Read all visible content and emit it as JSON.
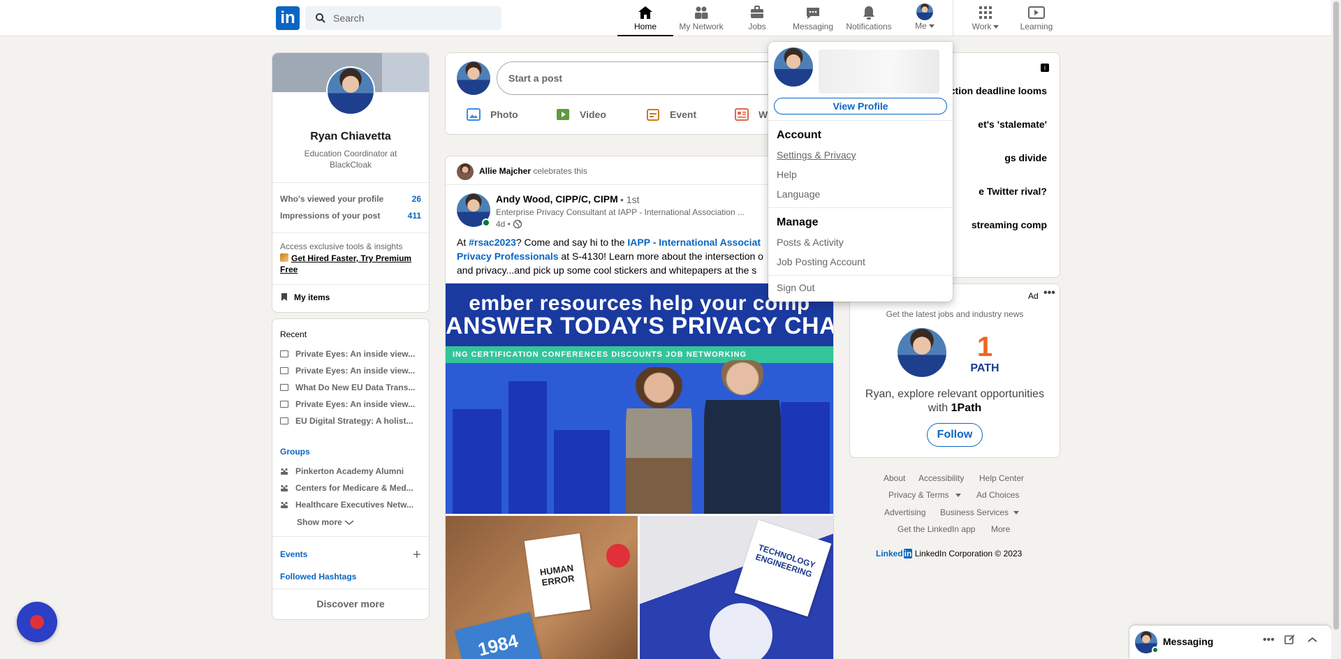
{
  "header": {
    "logo": "in",
    "search_placeholder": "Search",
    "nav": [
      {
        "label": "Home",
        "icon": "home-icon"
      },
      {
        "label": "My Network",
        "icon": "network-icon"
      },
      {
        "label": "Jobs",
        "icon": "briefcase-icon"
      },
      {
        "label": "Messaging",
        "icon": "messaging-icon"
      },
      {
        "label": "Notifications",
        "icon": "bell-icon"
      },
      {
        "label": "Me",
        "icon": "avatar"
      },
      {
        "label": "Work",
        "icon": "grid-icon"
      },
      {
        "label": "Learning",
        "icon": "learning-icon"
      }
    ]
  },
  "profile": {
    "name": "Ryan Chiavetta",
    "headline": "Education Coordinator at BlackCloak",
    "stats": [
      {
        "label": "Who's viewed your profile",
        "value": "26"
      },
      {
        "label": "Impressions of your post",
        "value": "411"
      }
    ],
    "premium_text": "Access exclusive tools & insights",
    "premium_link": "Get Hired Faster, Try Premium Free",
    "my_items": "My items"
  },
  "sidebar": {
    "recent_title": "Recent",
    "recent": [
      "Private Eyes: An inside view...",
      "Private Eyes: An inside view...",
      "What Do New EU Data Trans...",
      "Private Eyes: An inside view...",
      "EU Digital Strategy: A holist..."
    ],
    "groups_title": "Groups",
    "groups": [
      "Pinkerton Academy Alumni",
      "Centers for Medicare & Med...",
      "Healthcare Executives Netw..."
    ],
    "show_more": "Show more",
    "events": "Events",
    "hashtags": "Followed Hashtags",
    "discover": "Discover more"
  },
  "composer": {
    "placeholder": "Start a post",
    "actions": [
      {
        "label": "Photo",
        "color": "#378fe9"
      },
      {
        "label": "Video",
        "color": "#5f9b41"
      },
      {
        "label": "Event",
        "color": "#c37d16"
      },
      {
        "label": "Wr",
        "color": "#e06847"
      }
    ]
  },
  "post": {
    "celebrator": "Allie Majcher",
    "celebrates": "celebrates this",
    "author": "Andy Wood, CIPP/C, CIPM",
    "degree": "• 1st",
    "subtitle": "Enterprise Privacy Consultant at IAPP - International Association ...",
    "time": "4d •",
    "text_1": "At ",
    "tag_1": "#rsac2023",
    "text_2": "? Come and say hi to the ",
    "tag_2": "IAPP - International Associat",
    "tag_3": "Privacy Professionals",
    "text_3": " at S-4130! Learn more about the intersection o",
    "text_4": "and privacy...and pick up some cool stickers and whitepapers at the s",
    "image_banner_1": "ember resources help your comp",
    "image_banner_2": "ANSWER TODAY'S PRIVACY CHALLENG",
    "image_strip": "ING   CERTIFICATION   CONFERENCES   DISCOUNTS   JOB   NETWORKING",
    "book_1": "1984",
    "book_2": "HUMAN ERROR",
    "book_3": "TECHNOLOGY ENGINEERING"
  },
  "news": {
    "items": [
      "ction deadline looms",
      "et's 'stalemate'",
      "gs divide",
      "e Twitter rival?",
      "streaming comp"
    ]
  },
  "ad": {
    "label": "Ad",
    "subtitle": "Get the latest jobs and industry news",
    "logo_num": "1",
    "logo_text": "PATH",
    "text_pre": "Ryan, explore relevant opportunities with ",
    "text_company": "1Path",
    "follow": "Follow"
  },
  "footer": {
    "links": [
      "About",
      "Accessibility",
      "Help Center",
      "Privacy & Terms",
      "Ad Choices",
      "Advertising",
      "Business Services",
      "Get the LinkedIn app",
      "More"
    ],
    "brand_logo": "Linked",
    "brand_logo_in": "in",
    "copyright": "LinkedIn Corporation © 2023"
  },
  "me_menu": {
    "view_profile": "View Profile",
    "account_title": "Account",
    "account": [
      "Settings & Privacy",
      "Help",
      "Language"
    ],
    "manage_title": "Manage",
    "manage": [
      "Posts & Activity",
      "Job Posting Account"
    ],
    "sign_out": "Sign Out"
  },
  "messaging": {
    "label": "Messaging"
  }
}
